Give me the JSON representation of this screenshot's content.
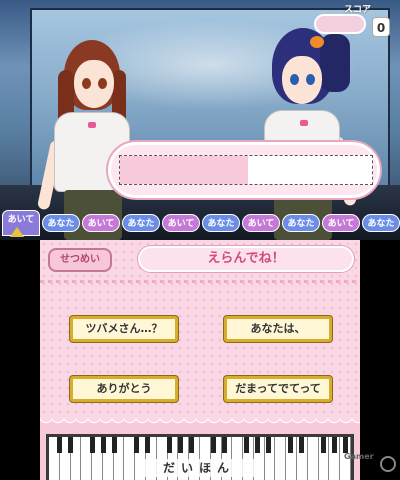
{
  "top": {
    "score_label": "スコア",
    "score_value": "0",
    "tabs": [
      "あいて",
      "あなた",
      "あいて",
      "あなた",
      "あいて",
      "あなた",
      "あいて",
      "あなた",
      "あいて",
      "あなた"
    ]
  },
  "bottom": {
    "explain_button": "せつめい",
    "prompt": "えらんでね！",
    "choices": [
      "ツバメさん…？",
      "あなたは、",
      "ありがとう",
      "だまってでてって"
    ],
    "keyboard_label": "だいほん"
  },
  "watermark": {
    "text": "Gamer"
  },
  "colors": {
    "accent_pink": "#d24a7f",
    "choice_border": "#d7ad2b",
    "tab_pink": "#c478d8",
    "tab_blue": "#6b8de6"
  }
}
